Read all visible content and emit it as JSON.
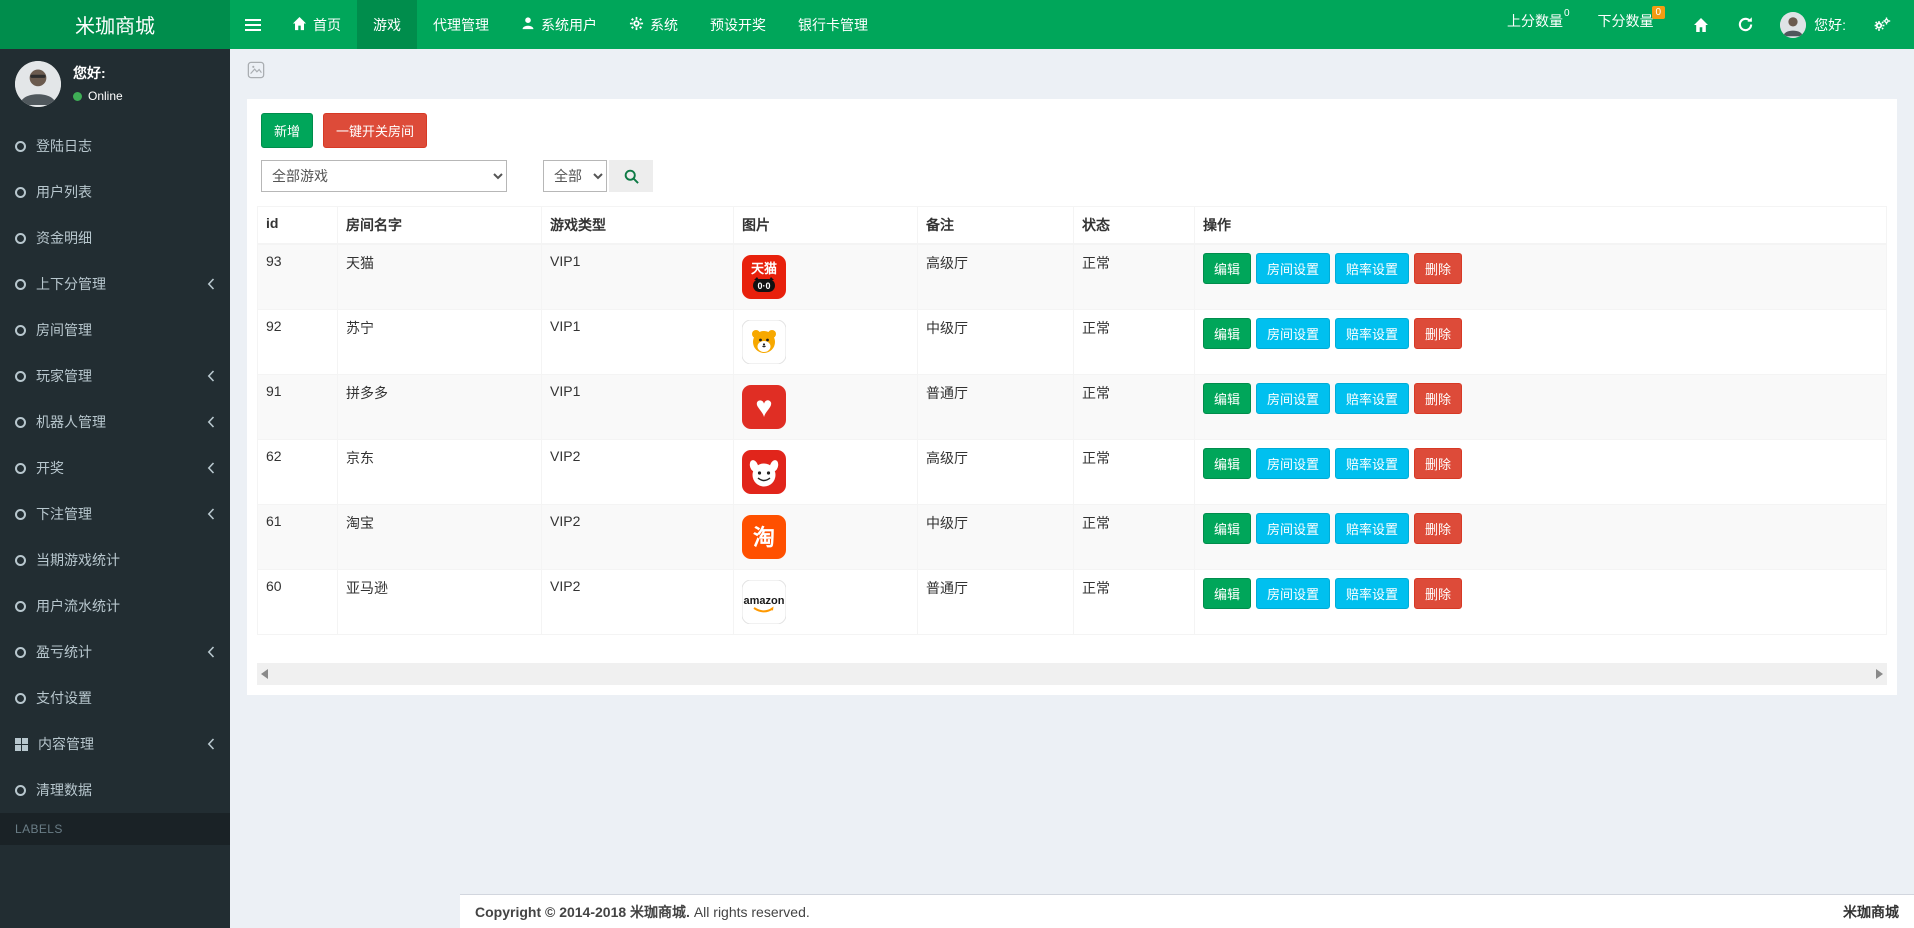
{
  "navbar": {
    "brand": "米珈商城",
    "items": [
      {
        "name": "home",
        "label": "首页",
        "icon": "home",
        "active": false
      },
      {
        "name": "games",
        "label": "游戏",
        "icon": null,
        "active": true
      },
      {
        "name": "agent-management",
        "label": "代理管理",
        "icon": null,
        "active": false
      },
      {
        "name": "system-users",
        "label": "系统用户",
        "icon": "user",
        "active": false
      },
      {
        "name": "system",
        "label": "系统",
        "icon": "gear",
        "active": false
      },
      {
        "name": "preset-draw",
        "label": "预设开奖",
        "icon": null,
        "active": false
      },
      {
        "name": "bank-card-management",
        "label": "银行卡管理",
        "icon": null,
        "active": false
      }
    ],
    "right": {
      "up_score_label": "上分数量",
      "up_score_count": "0",
      "down_score_label": "下分数量",
      "down_score_count": "0",
      "greeting": "您好:"
    }
  },
  "sidebar": {
    "greeting": "您好:",
    "status": "Online",
    "labels_header": "LABELS",
    "items": [
      {
        "name": "login-logs",
        "label": "登陆日志",
        "icon": "circle",
        "has_children": false
      },
      {
        "name": "user-list",
        "label": "用户列表",
        "icon": "circle",
        "has_children": false
      },
      {
        "name": "funds-detail",
        "label": "资金明细",
        "icon": "circle",
        "has_children": false
      },
      {
        "name": "score-management",
        "label": "上下分管理",
        "icon": "circle",
        "has_children": true
      },
      {
        "name": "room-management",
        "label": "房间管理",
        "icon": "circle",
        "has_children": false
      },
      {
        "name": "player-management",
        "label": "玩家管理",
        "icon": "circle",
        "has_children": true
      },
      {
        "name": "robot-management",
        "label": "机器人管理",
        "icon": "circle",
        "has_children": true
      },
      {
        "name": "lottery-draw",
        "label": "开奖",
        "icon": "circle",
        "has_children": true
      },
      {
        "name": "bet-management",
        "label": "下注管理",
        "icon": "circle",
        "has_children": true
      },
      {
        "name": "current-game-stats",
        "label": "当期游戏统计",
        "icon": "circle",
        "has_children": false
      },
      {
        "name": "user-turnover-stats",
        "label": "用户流水统计",
        "icon": "circle",
        "has_children": false
      },
      {
        "name": "profit-loss-stats",
        "label": "盈亏统计",
        "icon": "circle",
        "has_children": true
      },
      {
        "name": "payment-settings",
        "label": "支付设置",
        "icon": "circle",
        "has_children": false
      },
      {
        "name": "content-management",
        "label": "内容管理",
        "icon": "th",
        "has_children": true
      },
      {
        "name": "clean-data",
        "label": "清理数据",
        "icon": "circle",
        "has_children": false
      }
    ]
  },
  "toolbar": {
    "add_label": "新增",
    "toggle_rooms_label": "一键开关房间",
    "game_filter_value": "全部游戏",
    "status_filter_value": "全部"
  },
  "table": {
    "columns": [
      "id",
      "房间名字",
      "游戏类型",
      "图片",
      "备注",
      "状态",
      "操作"
    ],
    "actions": [
      {
        "name": "edit-button",
        "label": "编辑",
        "style": "success"
      },
      {
        "name": "room-settings-button",
        "label": "房间设置",
        "style": "info"
      },
      {
        "name": "odds-settings-button",
        "label": "赔率设置",
        "style": "info"
      },
      {
        "name": "delete-button",
        "label": "删除",
        "style": "danger"
      }
    ],
    "rows": [
      {
        "id": "93",
        "name": "天猫",
        "type": "VIP1",
        "icon": "tmall",
        "note": "高级厅",
        "status": "正常"
      },
      {
        "id": "92",
        "name": "苏宁",
        "type": "VIP1",
        "icon": "suning",
        "note": "中级厅",
        "status": "正常"
      },
      {
        "id": "91",
        "name": "拼多多",
        "type": "VIP1",
        "icon": "pdd",
        "note": "普通厅",
        "status": "正常"
      },
      {
        "id": "62",
        "name": "京东",
        "type": "VIP2",
        "icon": "jd",
        "note": "高级厅",
        "status": "正常"
      },
      {
        "id": "61",
        "name": "淘宝",
        "type": "VIP2",
        "icon": "taobao",
        "note": "中级厅",
        "status": "正常"
      },
      {
        "id": "60",
        "name": "亚马逊",
        "type": "VIP2",
        "icon": "amazon",
        "note": "普通厅",
        "status": "正常"
      }
    ]
  },
  "icons": {
    "tmall": {
      "text": "天猫",
      "sub": "0·0"
    },
    "taobao": {
      "text": "淘"
    },
    "amazon": {
      "text": "amazon"
    },
    "pdd": {
      "heart": "♥"
    }
  },
  "footer": {
    "copyright_bold": "Copyright © 2014-2018 米珈商城.",
    "copyright_rest": " All rights reserved.",
    "brand": "米珈商城"
  },
  "colors": {
    "navbar_green": "#00a65a",
    "brand_green": "#008d4c",
    "sidebar_dark": "#222d32",
    "badge_orange": "#f39c12",
    "danger_red": "#dd4b39",
    "info_cyan": "#00c0ef",
    "content_bg": "#ecf0f5"
  }
}
